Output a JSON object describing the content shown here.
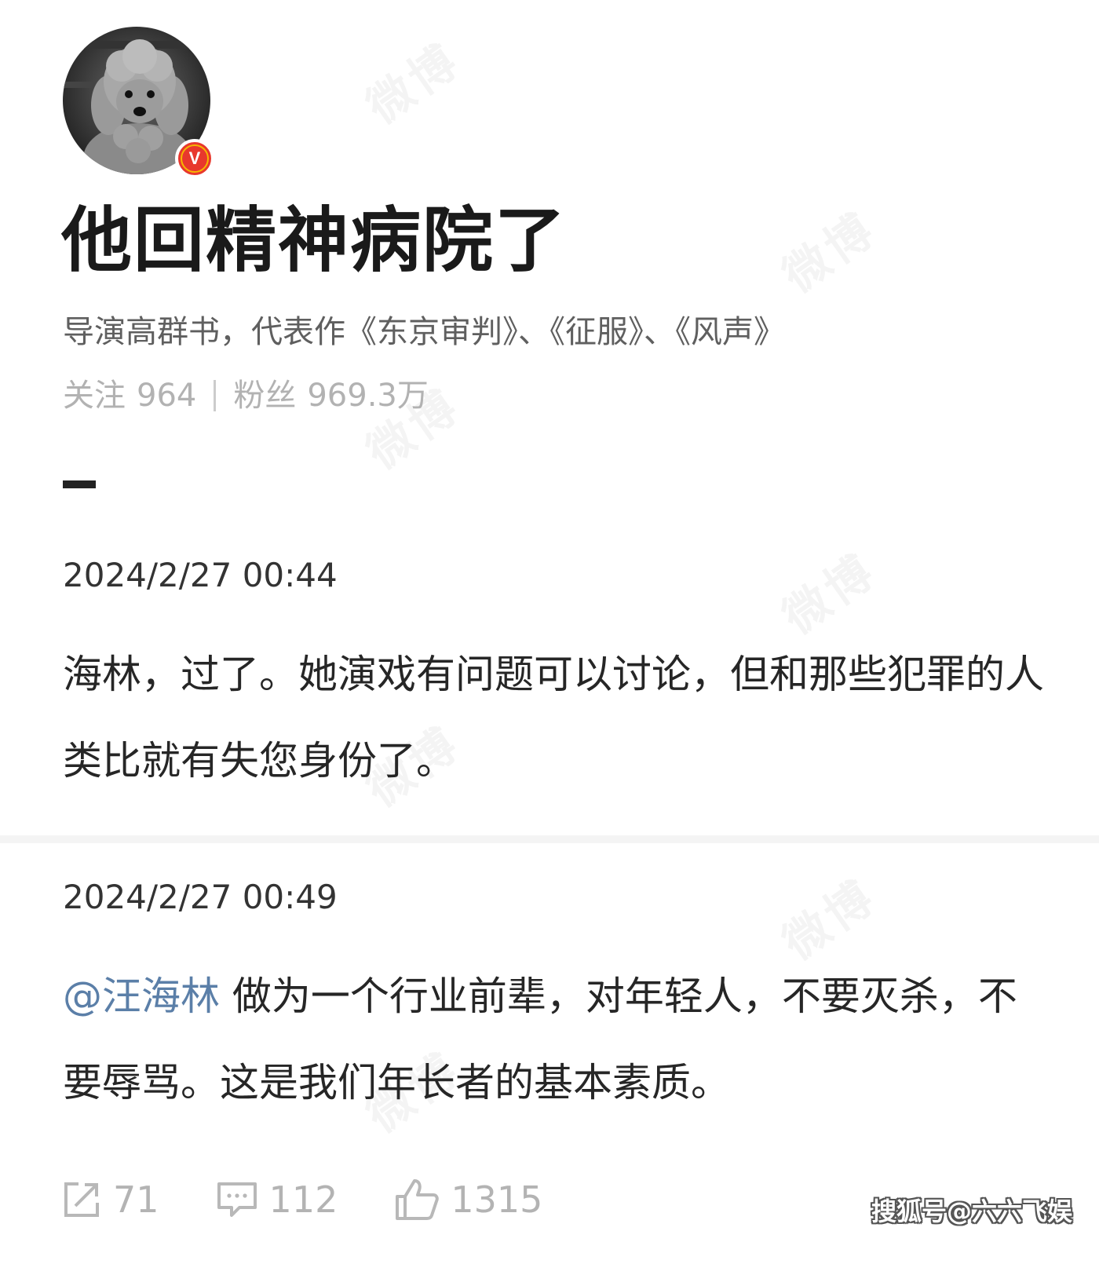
{
  "profile": {
    "name": "他回精神病院了",
    "bio": "导演高群书，代表作《东京审判》、《征服》、《风声》",
    "following_label": "关注",
    "following_count": "964",
    "followers_label": "粉丝",
    "followers_count": "969.3万",
    "verified_badge": "V"
  },
  "posts": [
    {
      "timestamp": "2024/2/27 00:44",
      "text": "海林，过了。她演戏有问题可以讨论，但和那些犯罪的人类比就有失您身份了。"
    },
    {
      "timestamp": "2024/2/27 00:49",
      "mention": "@汪海林",
      "text": "做为一个行业前辈，对年轻人，不要灭杀，不要辱骂。这是我们年长者的基本素质。"
    }
  ],
  "actions": {
    "repost_count": "71",
    "comment_count": "112",
    "like_count": "1315"
  },
  "watermark": "微博",
  "source_watermark": "搜狐号@六六飞娱",
  "colors": {
    "mention": "#5b7fa8",
    "verified_badge": "#e8382d",
    "muted_text": "#b2b2b2"
  },
  "icons": [
    "repost-icon",
    "comment-icon",
    "like-icon",
    "verified-badge-icon"
  ]
}
